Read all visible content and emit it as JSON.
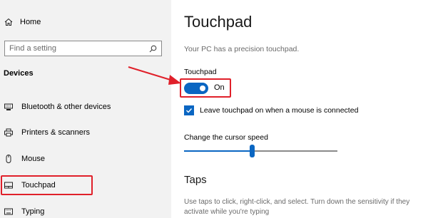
{
  "sidebar": {
    "home_label": "Home",
    "search_placeholder": "Find a setting",
    "section_title": "Devices",
    "items": [
      {
        "label": "Bluetooth & other devices",
        "icon": "bluetooth-devices-icon"
      },
      {
        "label": "Printers & scanners",
        "icon": "printer-icon"
      },
      {
        "label": "Mouse",
        "icon": "mouse-icon"
      },
      {
        "label": "Touchpad",
        "icon": "touchpad-icon",
        "selected": true
      },
      {
        "label": "Typing",
        "icon": "keyboard-icon"
      }
    ]
  },
  "main": {
    "title": "Touchpad",
    "subtitle": "Your PC has a precision touchpad.",
    "touchpad_label": "Touchpad",
    "toggle_state": "On",
    "checkbox_label": "Leave touchpad on when a mouse is connected",
    "checkbox_checked": true,
    "cursor_speed_label": "Change the cursor speed",
    "taps_title": "Taps",
    "taps_description": "Use taps to click, right-click, and select. Turn down the sensitivity if they activate while you're typing"
  },
  "colors": {
    "accent": "#0a66c2",
    "annotation_red": "#e0202a",
    "sidebar_bg": "#f2f2f2"
  }
}
